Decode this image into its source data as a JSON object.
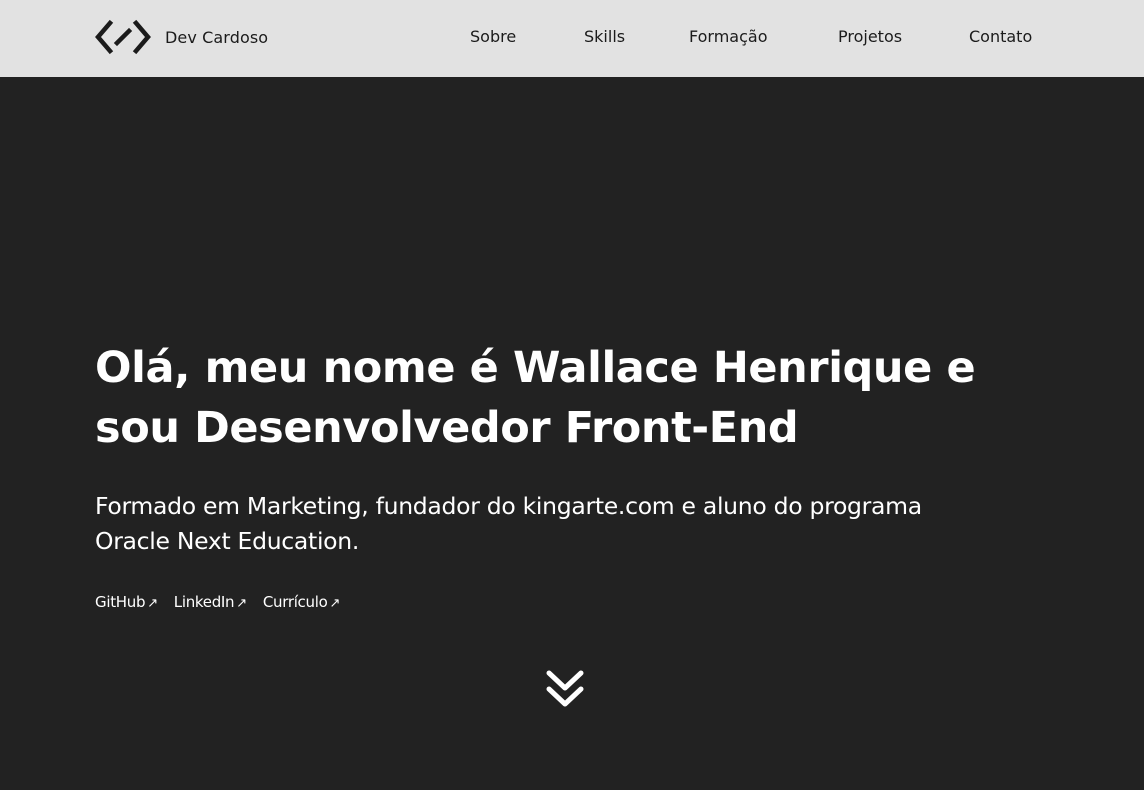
{
  "header": {
    "brand": {
      "name": "Dev Cardoso",
      "logo_icon": "code-brackets-icon"
    },
    "nav": [
      {
        "label": "Sobre"
      },
      {
        "label": "Skills"
      },
      {
        "label": "Formação"
      },
      {
        "label": "Projetos"
      },
      {
        "label": "Contato"
      }
    ]
  },
  "hero": {
    "title_line1": "Olá, meu nome é Wallace Henrique e",
    "title_line2": "sou Desenvolvedor Front-End",
    "subtitle_line1": "Formado em Marketing, fundador do kingarte.com e aluno do programa",
    "subtitle_line2": "Oracle Next Education.",
    "links": [
      {
        "label": "GitHub",
        "arrow": "↗"
      },
      {
        "label": "LinkedIn",
        "arrow": "↗"
      },
      {
        "label": "Currículo",
        "arrow": "↗"
      }
    ],
    "scroll_icon": "double-chevron-down-icon"
  },
  "colors": {
    "header_bg": "#e2e2e2",
    "page_bg": "#222222",
    "text_dark": "#1b1b1b",
    "text_light": "#ffffff"
  }
}
